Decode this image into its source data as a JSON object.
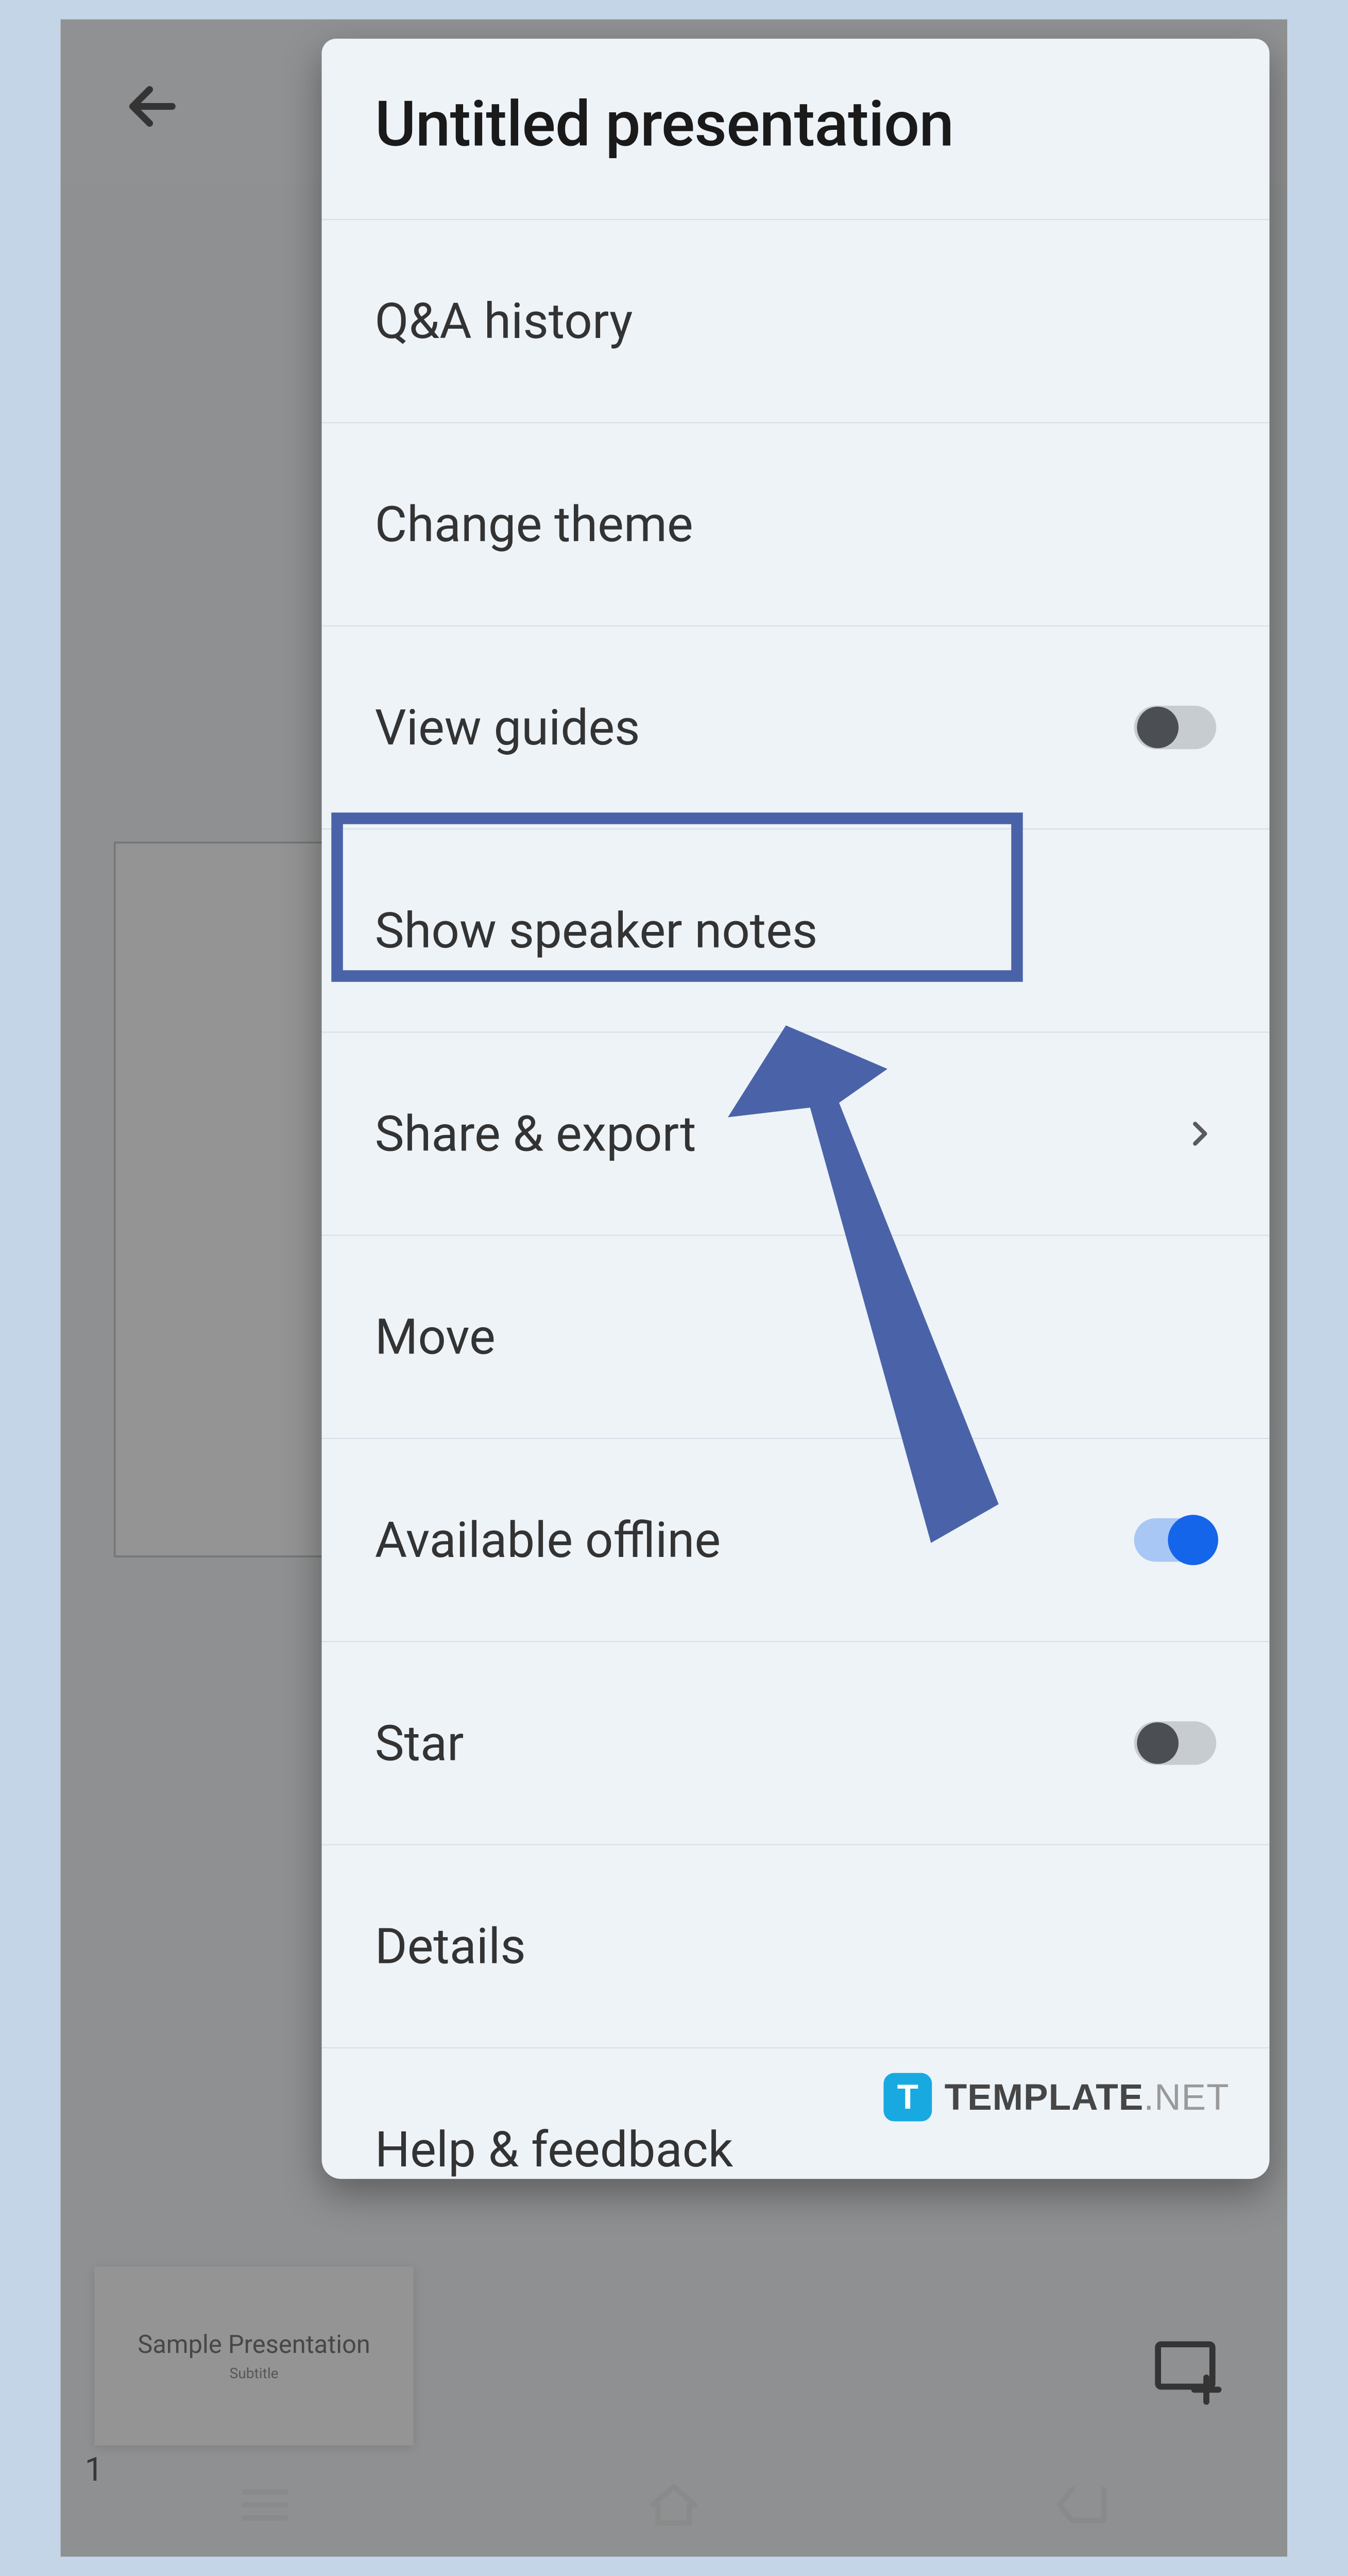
{
  "app": {
    "title": "Untitled presentation",
    "thumb_title": "Sample Presentation",
    "thumb_sub": "Subtitle",
    "slide_number": "1"
  },
  "menu": {
    "items": [
      {
        "label": "Q&A history",
        "type": "plain"
      },
      {
        "label": "Change theme",
        "type": "plain"
      },
      {
        "label": "View guides",
        "type": "toggle",
        "on": false
      },
      {
        "label": "Show speaker notes",
        "type": "plain",
        "highlighted": true
      },
      {
        "label": "Share & export",
        "type": "nav"
      },
      {
        "label": "Move",
        "type": "plain"
      },
      {
        "label": "Available offline",
        "type": "toggle",
        "on": true
      },
      {
        "label": "Star",
        "type": "toggle",
        "on": false
      },
      {
        "label": "Details",
        "type": "plain"
      },
      {
        "label": "Help & feedback",
        "type": "plain"
      }
    ]
  },
  "watermark": {
    "badge": "T",
    "brand": "TEMPLATE",
    "suffix": ".NET"
  },
  "annotation": {
    "highlight_color": "#4a63a8",
    "arrow_color": "#4a63a8"
  }
}
